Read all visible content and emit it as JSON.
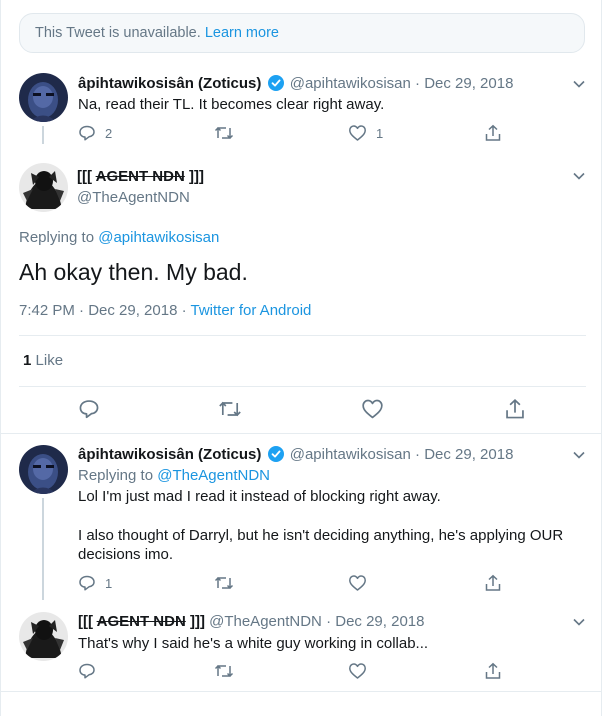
{
  "unavailable": {
    "text": "This Tweet is unavailable.",
    "link": "Learn more"
  },
  "tweet1": {
    "name": "âpihtawikosisân (Zoticus)",
    "handle": "@apihtawikosisan",
    "dot": "·",
    "date": "Dec 29, 2018",
    "text": "Na, read their TL. It becomes clear right away.",
    "reply_count": "2",
    "like_count": "1"
  },
  "main_tweet": {
    "name_prefix": "[[[ ",
    "name_strike": "AGENT NDN",
    "name_suffix": " ]]]",
    "handle": "@TheAgentNDN",
    "replying_to_label": "Replying to",
    "replying_to_mention": "@apihtawikosisan",
    "text": "Ah okay then. My bad.",
    "timestamp": "7:42 PM · Dec 29, 2018",
    "source_sep": " · ",
    "source": "Twitter for Android",
    "likes_count": "1",
    "likes_label": "Like"
  },
  "tweet3": {
    "name": "âpihtawikosisân (Zoticus)",
    "handle": "@apihtawikosisan",
    "dot": "·",
    "date": "Dec 29, 2018",
    "replying_to_label": "Replying to",
    "replying_to_mention": "@TheAgentNDN",
    "line1": "Lol I'm just mad I read it instead of blocking right away.",
    "line2": "I also thought of Darryl, but he isn't deciding anything, he's applying OUR",
    "line3": "decisions imo.",
    "reply_count": "1"
  },
  "tweet4": {
    "name_prefix": "[[[ ",
    "name_strike": "AGENT NDN",
    "name_suffix": " ]]]",
    "handle": "@TheAgentNDN",
    "dot": "·",
    "date": "Dec 29, 2018",
    "text": "That's why I said he's a white guy working in collab..."
  },
  "colors": {
    "accent": "#1b95e0",
    "muted": "#657786",
    "verified": "#1da1f2",
    "border": "#e6ecf0"
  },
  "icons": [
    "reply-icon",
    "retweet-icon",
    "like-icon",
    "share-icon",
    "verified-badge-icon",
    "chevron-down-icon"
  ]
}
